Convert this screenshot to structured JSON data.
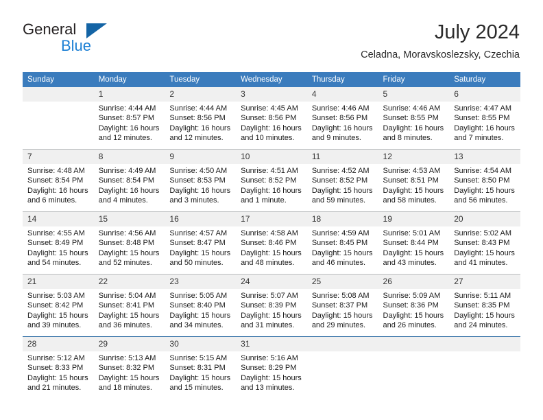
{
  "brand": {
    "name_line1": "General",
    "name_line2": "Blue",
    "accent_dark": "#1464a5",
    "accent_light": "#1b7fd4"
  },
  "header": {
    "title": "July 2024",
    "subtitle": "Celadna, Moravskoslezsky, Czechia"
  },
  "theme": {
    "header_bg": "#3b7cbd",
    "daynum_bg": "#f0f0f0",
    "row_divider": "#b9bcbe",
    "accent_divider": "#2e6da4"
  },
  "weekdays": [
    "Sunday",
    "Monday",
    "Tuesday",
    "Wednesday",
    "Thursday",
    "Friday",
    "Saturday"
  ],
  "labels": {
    "sunrise_prefix": "Sunrise:",
    "sunset_prefix": "Sunset:",
    "daylight_prefix": "Daylight:"
  },
  "weeks": [
    [
      {
        "day": "",
        "blank": true
      },
      {
        "day": "1",
        "sunrise": "Sunrise: 4:44 AM",
        "sunset": "Sunset: 8:57 PM",
        "daylight_1": "Daylight: 16 hours",
        "daylight_2": "and 12 minutes."
      },
      {
        "day": "2",
        "sunrise": "Sunrise: 4:44 AM",
        "sunset": "Sunset: 8:56 PM",
        "daylight_1": "Daylight: 16 hours",
        "daylight_2": "and 12 minutes."
      },
      {
        "day": "3",
        "sunrise": "Sunrise: 4:45 AM",
        "sunset": "Sunset: 8:56 PM",
        "daylight_1": "Daylight: 16 hours",
        "daylight_2": "and 10 minutes."
      },
      {
        "day": "4",
        "sunrise": "Sunrise: 4:46 AM",
        "sunset": "Sunset: 8:56 PM",
        "daylight_1": "Daylight: 16 hours",
        "daylight_2": "and 9 minutes."
      },
      {
        "day": "5",
        "sunrise": "Sunrise: 4:46 AM",
        "sunset": "Sunset: 8:55 PM",
        "daylight_1": "Daylight: 16 hours",
        "daylight_2": "and 8 minutes."
      },
      {
        "day": "6",
        "sunrise": "Sunrise: 4:47 AM",
        "sunset": "Sunset: 8:55 PM",
        "daylight_1": "Daylight: 16 hours",
        "daylight_2": "and 7 minutes."
      }
    ],
    [
      {
        "day": "7",
        "sunrise": "Sunrise: 4:48 AM",
        "sunset": "Sunset: 8:54 PM",
        "daylight_1": "Daylight: 16 hours",
        "daylight_2": "and 6 minutes."
      },
      {
        "day": "8",
        "sunrise": "Sunrise: 4:49 AM",
        "sunset": "Sunset: 8:54 PM",
        "daylight_1": "Daylight: 16 hours",
        "daylight_2": "and 4 minutes."
      },
      {
        "day": "9",
        "sunrise": "Sunrise: 4:50 AM",
        "sunset": "Sunset: 8:53 PM",
        "daylight_1": "Daylight: 16 hours",
        "daylight_2": "and 3 minutes."
      },
      {
        "day": "10",
        "sunrise": "Sunrise: 4:51 AM",
        "sunset": "Sunset: 8:52 PM",
        "daylight_1": "Daylight: 16 hours",
        "daylight_2": "and 1 minute."
      },
      {
        "day": "11",
        "sunrise": "Sunrise: 4:52 AM",
        "sunset": "Sunset: 8:52 PM",
        "daylight_1": "Daylight: 15 hours",
        "daylight_2": "and 59 minutes."
      },
      {
        "day": "12",
        "sunrise": "Sunrise: 4:53 AM",
        "sunset": "Sunset: 8:51 PM",
        "daylight_1": "Daylight: 15 hours",
        "daylight_2": "and 58 minutes."
      },
      {
        "day": "13",
        "sunrise": "Sunrise: 4:54 AM",
        "sunset": "Sunset: 8:50 PM",
        "daylight_1": "Daylight: 15 hours",
        "daylight_2": "and 56 minutes."
      }
    ],
    [
      {
        "day": "14",
        "sunrise": "Sunrise: 4:55 AM",
        "sunset": "Sunset: 8:49 PM",
        "daylight_1": "Daylight: 15 hours",
        "daylight_2": "and 54 minutes."
      },
      {
        "day": "15",
        "sunrise": "Sunrise: 4:56 AM",
        "sunset": "Sunset: 8:48 PM",
        "daylight_1": "Daylight: 15 hours",
        "daylight_2": "and 52 minutes."
      },
      {
        "day": "16",
        "sunrise": "Sunrise: 4:57 AM",
        "sunset": "Sunset: 8:47 PM",
        "daylight_1": "Daylight: 15 hours",
        "daylight_2": "and 50 minutes."
      },
      {
        "day": "17",
        "sunrise": "Sunrise: 4:58 AM",
        "sunset": "Sunset: 8:46 PM",
        "daylight_1": "Daylight: 15 hours",
        "daylight_2": "and 48 minutes."
      },
      {
        "day": "18",
        "sunrise": "Sunrise: 4:59 AM",
        "sunset": "Sunset: 8:45 PM",
        "daylight_1": "Daylight: 15 hours",
        "daylight_2": "and 46 minutes."
      },
      {
        "day": "19",
        "sunrise": "Sunrise: 5:01 AM",
        "sunset": "Sunset: 8:44 PM",
        "daylight_1": "Daylight: 15 hours",
        "daylight_2": "and 43 minutes."
      },
      {
        "day": "20",
        "sunrise": "Sunrise: 5:02 AM",
        "sunset": "Sunset: 8:43 PM",
        "daylight_1": "Daylight: 15 hours",
        "daylight_2": "and 41 minutes."
      }
    ],
    [
      {
        "day": "21",
        "sunrise": "Sunrise: 5:03 AM",
        "sunset": "Sunset: 8:42 PM",
        "daylight_1": "Daylight: 15 hours",
        "daylight_2": "and 39 minutes."
      },
      {
        "day": "22",
        "sunrise": "Sunrise: 5:04 AM",
        "sunset": "Sunset: 8:41 PM",
        "daylight_1": "Daylight: 15 hours",
        "daylight_2": "and 36 minutes."
      },
      {
        "day": "23",
        "sunrise": "Sunrise: 5:05 AM",
        "sunset": "Sunset: 8:40 PM",
        "daylight_1": "Daylight: 15 hours",
        "daylight_2": "and 34 minutes."
      },
      {
        "day": "24",
        "sunrise": "Sunrise: 5:07 AM",
        "sunset": "Sunset: 8:39 PM",
        "daylight_1": "Daylight: 15 hours",
        "daylight_2": "and 31 minutes."
      },
      {
        "day": "25",
        "sunrise": "Sunrise: 5:08 AM",
        "sunset": "Sunset: 8:37 PM",
        "daylight_1": "Daylight: 15 hours",
        "daylight_2": "and 29 minutes."
      },
      {
        "day": "26",
        "sunrise": "Sunrise: 5:09 AM",
        "sunset": "Sunset: 8:36 PM",
        "daylight_1": "Daylight: 15 hours",
        "daylight_2": "and 26 minutes."
      },
      {
        "day": "27",
        "sunrise": "Sunrise: 5:11 AM",
        "sunset": "Sunset: 8:35 PM",
        "daylight_1": "Daylight: 15 hours",
        "daylight_2": "and 24 minutes."
      }
    ],
    [
      {
        "day": "28",
        "sunrise": "Sunrise: 5:12 AM",
        "sunset": "Sunset: 8:33 PM",
        "daylight_1": "Daylight: 15 hours",
        "daylight_2": "and 21 minutes."
      },
      {
        "day": "29",
        "sunrise": "Sunrise: 5:13 AM",
        "sunset": "Sunset: 8:32 PM",
        "daylight_1": "Daylight: 15 hours",
        "daylight_2": "and 18 minutes."
      },
      {
        "day": "30",
        "sunrise": "Sunrise: 5:15 AM",
        "sunset": "Sunset: 8:31 PM",
        "daylight_1": "Daylight: 15 hours",
        "daylight_2": "and 15 minutes."
      },
      {
        "day": "31",
        "sunrise": "Sunrise: 5:16 AM",
        "sunset": "Sunset: 8:29 PM",
        "daylight_1": "Daylight: 15 hours",
        "daylight_2": "and 13 minutes."
      },
      {
        "day": "",
        "blank": true
      },
      {
        "day": "",
        "blank": true
      },
      {
        "day": "",
        "blank": true
      }
    ]
  ]
}
